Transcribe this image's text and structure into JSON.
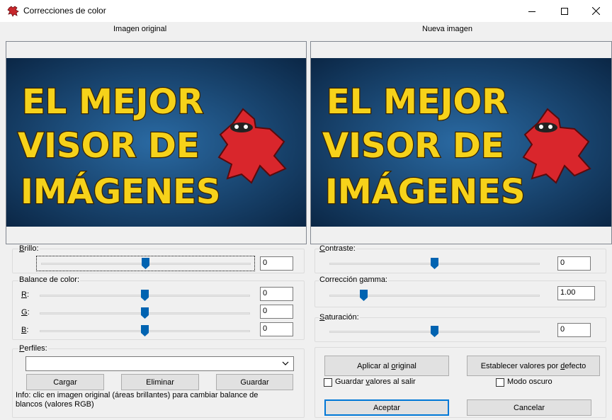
{
  "window": {
    "title": "Correcciones de color",
    "minimize": "minimize",
    "maximize": "maximize",
    "close": "close"
  },
  "panels": {
    "original_label": "Imagen original",
    "new_label": "Nueva imagen",
    "image_text": [
      "EL MEJOR",
      "VISOR DE",
      "IMÁGENES"
    ],
    "image_colors": {
      "bg": "#1a4a78",
      "text": "#f6d21a",
      "outline": "#3a2400",
      "mascot": "#d9262c"
    }
  },
  "brillo": {
    "label": "Brillo:",
    "value": "0",
    "level": 0.5
  },
  "balance": {
    "label": "Balance de color:",
    "channels": [
      {
        "label": "R:",
        "value": "0",
        "level": 0.5
      },
      {
        "label": "G:",
        "value": "0",
        "level": 0.5
      },
      {
        "label": "B:",
        "value": "0",
        "level": 0.5
      }
    ]
  },
  "perfiles": {
    "label": "Perfiles:",
    "selected": "",
    "load": "Cargar",
    "delete": "Eliminar",
    "save": "Guardar"
  },
  "info": "Info: clic en imagen original (áreas brillantes) para cambiar balance de blancos (valores RGB)",
  "contraste": {
    "label": "Contraste:",
    "value": "0",
    "level": 0.5
  },
  "gamma": {
    "label": "Corrección gamma:",
    "value": "1.00",
    "level": 0.15
  },
  "saturacion": {
    "label": "Saturación:",
    "value": "0",
    "level": 0.5
  },
  "actions": {
    "apply_original": "Aplicar al original",
    "set_defaults": "Establecer valores por defecto",
    "save_on_exit": "Guardar valores al salir",
    "dark_mode": "Modo oscuro",
    "accept": "Aceptar",
    "cancel": "Cancelar"
  },
  "colors": {
    "accent": "#0078d7",
    "slider_thumb": "#0063b1"
  }
}
